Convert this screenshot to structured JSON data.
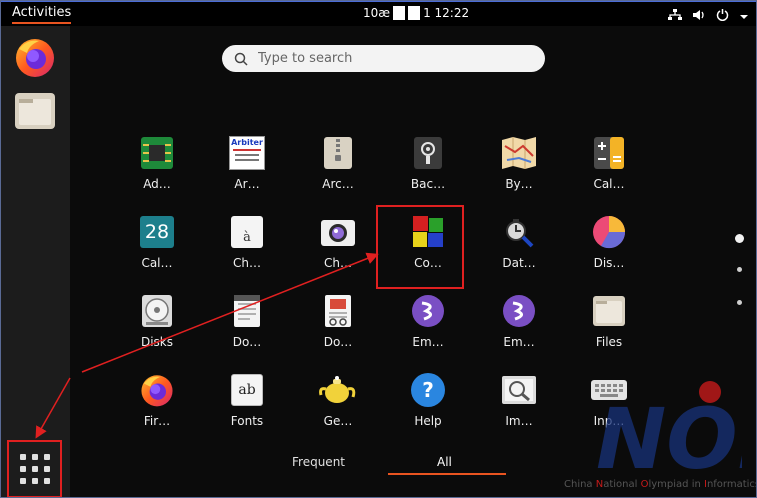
{
  "topbar": {
    "activities": "Activities",
    "clock_prefix": "10æ",
    "clock_suffix": "1 12:22"
  },
  "dock": {
    "items": [
      {
        "name": "firefox"
      },
      {
        "name": "files"
      }
    ]
  },
  "search": {
    "placeholder": "Type to search"
  },
  "apps": [
    {
      "label": "Ad…"
    },
    {
      "label": "Ar…"
    },
    {
      "label": "Arc…"
    },
    {
      "label": "Bac…"
    },
    {
      "label": "By…"
    },
    {
      "label": "Cal…"
    },
    {
      "label": "Cal…"
    },
    {
      "label": "Ch…"
    },
    {
      "label": "Ch…"
    },
    {
      "label": "Co…"
    },
    {
      "label": "Dat…"
    },
    {
      "label": "Dis…"
    },
    {
      "label": "Disks"
    },
    {
      "label": "Do…"
    },
    {
      "label": "Do…"
    },
    {
      "label": "Em…"
    },
    {
      "label": "Em…"
    },
    {
      "label": "Files"
    },
    {
      "label": "Fir…"
    },
    {
      "label": "Fonts"
    },
    {
      "label": "Ge…"
    },
    {
      "label": "Help"
    },
    {
      "label": "Im…"
    },
    {
      "label": "Inp…"
    }
  ],
  "app_icons": {
    "arbiter_text": "Arbiter",
    "calendar_day": "28",
    "charmap_glyph": "à",
    "fonts_glyph": "ab",
    "help_glyph": "?"
  },
  "tabs": {
    "frequent": "Frequent",
    "all": "All"
  },
  "watermark": {
    "logo": "NOI",
    "parts": [
      "China ",
      "N",
      "ational ",
      "O",
      "lympiad in ",
      "I",
      "nformatics"
    ]
  },
  "colors": {
    "accent": "#e95420",
    "annotation": "#e02020"
  }
}
